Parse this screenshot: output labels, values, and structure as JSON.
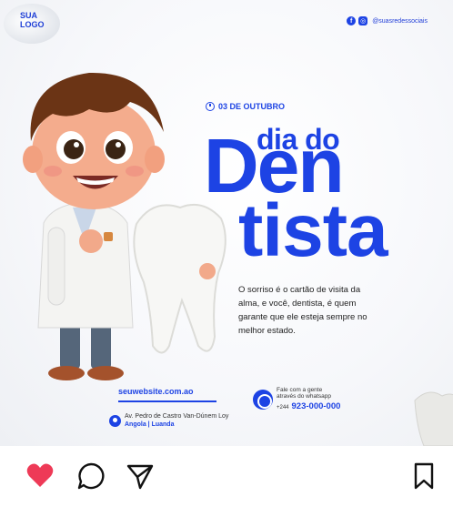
{
  "post": {
    "logo": [
      "SUA",
      "LOGO"
    ],
    "social_handle": "@suasredessociais",
    "date": "03 DE OUTUBRO",
    "title_small": "dia do",
    "title_big_1": "Den",
    "title_big_2": "tista",
    "body": "O sorriso é o cartão de visita da alma, e você, dentista, é quem garante que ele esteja sempre no melhor estado.",
    "website": "seuwebsite.com.ao",
    "address_line1": "Av. Pedro de Castro Van-Dúnem Loy",
    "address_line2": "Angola | Luanda",
    "whatsapp_label_1": "Fale com a gente",
    "whatsapp_label_2": "através do whatsapp",
    "phone_prefix": "+244",
    "phone": "923-000-000",
    "colors": {
      "brand": "#1d43e4",
      "heart": "#ee3a57"
    }
  },
  "actions": {
    "like": {
      "icon": "heart-icon",
      "state": "liked"
    },
    "comment": {
      "icon": "comment-icon"
    },
    "share": {
      "icon": "share-icon"
    },
    "save": {
      "icon": "bookmark-icon"
    }
  }
}
